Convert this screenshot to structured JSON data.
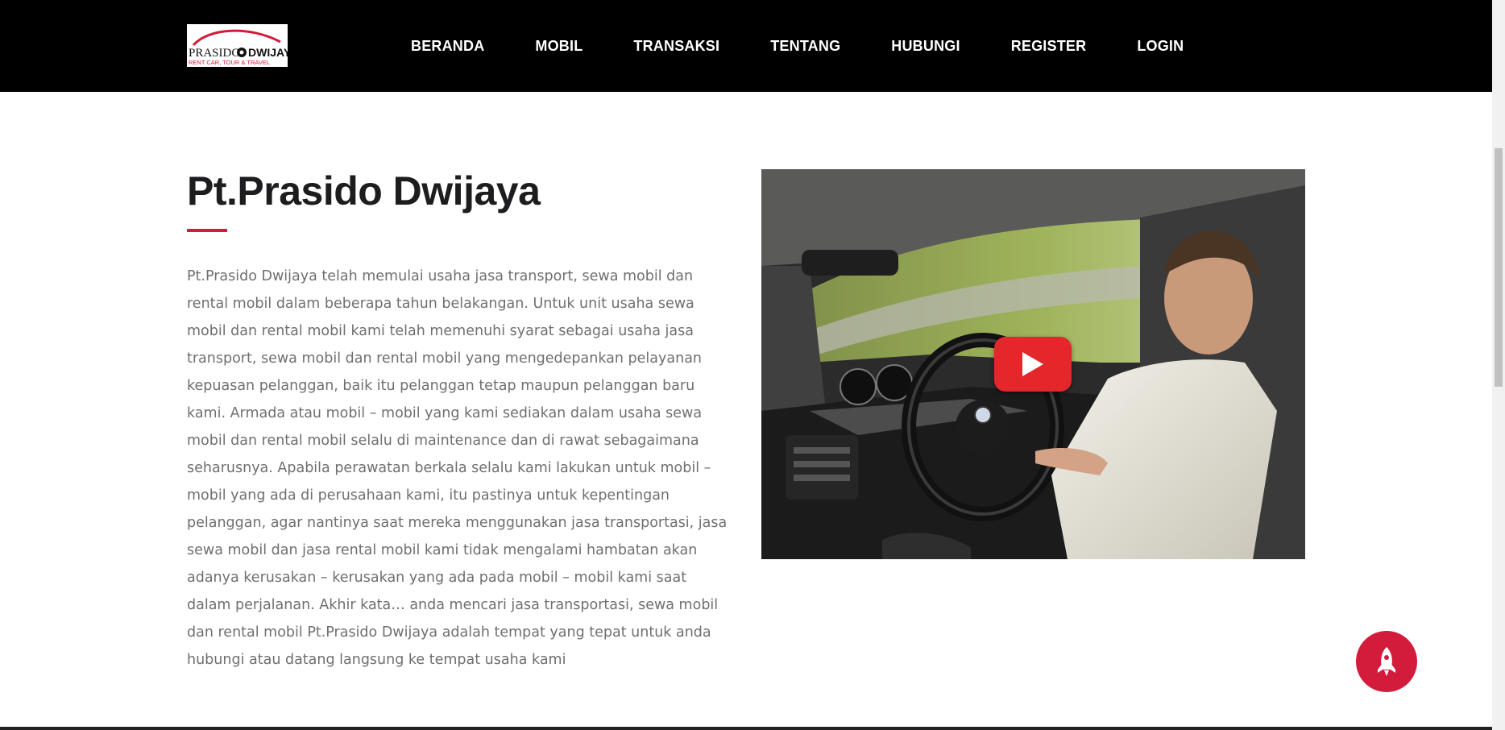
{
  "navbar": {
    "logo": {
      "brand_left": "PRASIDO",
      "brand_right": "DWIJAYA",
      "tagline": "RENT CAR, TOUR & TRAVEL",
      "accent_color": "#d31c3b"
    },
    "links": [
      {
        "label": "BERANDA"
      },
      {
        "label": "MOBIL"
      },
      {
        "label": "TRANSAKSI"
      },
      {
        "label": "TENTANG"
      },
      {
        "label": "HUBUNGI"
      },
      {
        "label": "REGISTER"
      },
      {
        "label": "LOGIN"
      }
    ]
  },
  "about": {
    "title": "Pt.Prasido Dwijaya",
    "accent_color": "#d31c3b",
    "body": "Pt.Prasido Dwijaya telah memulai usaha jasa transport, sewa mobil dan rental mobil dalam beberapa tahun belakangan. Untuk unit usaha sewa mobil dan rental mobil kami telah memenuhi syarat sebagai usaha jasa transport, sewa mobil dan rental mobil yang mengedepankan pelayanan kepuasan pelanggan, baik itu pelanggan tetap maupun pelanggan baru kami. Armada atau mobil – mobil yang kami sediakan dalam usaha sewa mobil dan rental mobil selalu di maintenance dan di rawat sebagaimana seharusnya. Apabila perawatan berkala selalu kami lakukan untuk mobil – mobil yang ada di perusahaan kami, itu pastinya untuk kepentingan pelanggan, agar nantinya saat mereka menggunakan jasa transportasi, jasa sewa mobil dan jasa rental mobil kami tidak mengalami hambatan akan adanya kerusakan – kerusakan yang ada pada mobil – mobil kami saat dalam perjalanan. Akhir kata… anda mencari jasa transportasi, sewa mobil dan rental mobil Pt.Prasido Dwijaya adalah tempat yang tepat untuk anda hubungi atau datang langsung ke tempat usaha kami"
  },
  "video": {
    "thumbnail": "man-driving-car-interior",
    "play_icon": "youtube-play-icon",
    "play_color": "#e3272b"
  },
  "scroll_top": {
    "icon": "rocket-icon",
    "color": "#d31c3b"
  }
}
